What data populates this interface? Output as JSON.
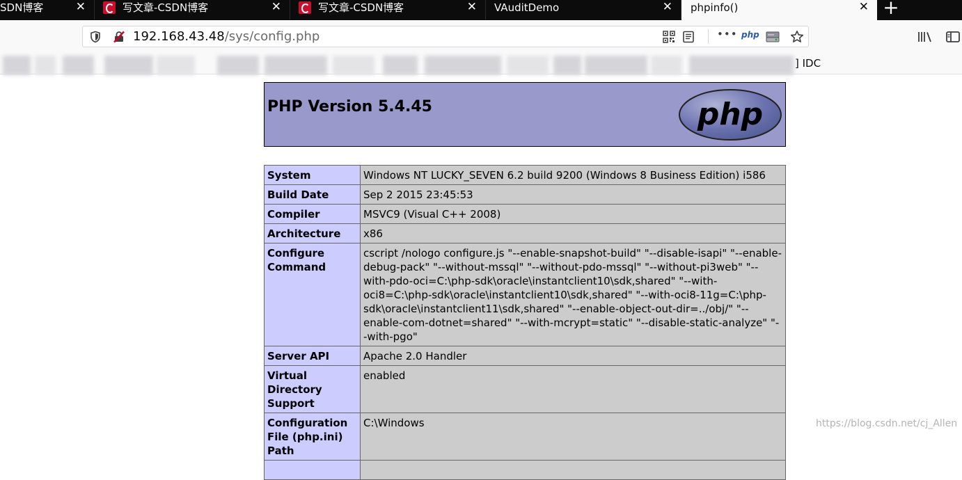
{
  "tabs": [
    {
      "title": "SDN博客",
      "icon": "",
      "active": false,
      "close": "✕"
    },
    {
      "title": "写文章-CSDN博客",
      "icon": "csdn-icon",
      "active": false,
      "close": "✕"
    },
    {
      "title": "写文章-CSDN博客",
      "icon": "csdn-icon",
      "active": false,
      "close": "✕"
    },
    {
      "title": "VAuditDemo",
      "icon": "",
      "active": false,
      "close": "✕"
    },
    {
      "title": "phpinfo()",
      "icon": "",
      "active": true,
      "close": "✕"
    }
  ],
  "new_tab_label": "+",
  "urlbar": {
    "host": "192.168.43.48",
    "path": "/sys/config.php"
  },
  "url_actions": {
    "more": "•••",
    "php_badge": "php"
  },
  "bookmarks": {
    "visible_tail": "] IDC"
  },
  "php": {
    "version_title": "PHP Version 5.4.45",
    "logo_text": "php",
    "rows": [
      {
        "key": "System",
        "value": "Windows NT LUCKY_SEVEN 6.2 build 9200 (Windows 8 Business Edition) i586"
      },
      {
        "key": "Build Date",
        "value": "Sep 2 2015 23:45:53"
      },
      {
        "key": "Compiler",
        "value": "MSVC9 (Visual C++ 2008)"
      },
      {
        "key": "Architecture",
        "value": "x86"
      },
      {
        "key": "Configure Command",
        "value": "cscript /nologo configure.js \"--enable-snapshot-build\" \"--disable-isapi\" \"--enable-debug-pack\" \"--without-mssql\" \"--without-pdo-mssql\" \"--without-pi3web\" \"--with-pdo-oci=C:\\php-sdk\\oracle\\instantclient10\\sdk,shared\" \"--with-oci8=C:\\php-sdk\\oracle\\instantclient10\\sdk,shared\" \"--with-oci8-11g=C:\\php-sdk\\oracle\\instantclient11\\sdk,shared\" \"--enable-object-out-dir=../obj/\" \"--enable-com-dotnet=shared\" \"--with-mcrypt=static\" \"--disable-static-analyze\" \"--with-pgo\""
      },
      {
        "key": "Server API",
        "value": "Apache 2.0 Handler"
      },
      {
        "key": "Virtual Directory Support",
        "value": "enabled"
      },
      {
        "key": "Configuration File (php.ini) Path",
        "value": "C:\\Windows"
      },
      {
        "key": "",
        "value": ""
      }
    ]
  },
  "watermark": "https://blog.csdn.net/cj_Allen",
  "colors": {
    "tabstrip": "#0c0c0d",
    "php_header": "#9999cc",
    "key_cell": "#ccccff",
    "value_cell": "#cccccc",
    "csdn_red": "#c8102e"
  }
}
